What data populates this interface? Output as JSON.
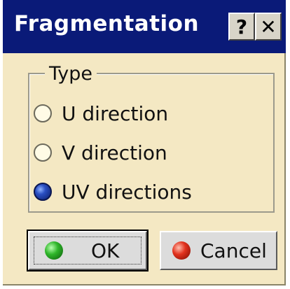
{
  "window": {
    "title": "Fragmentation",
    "help_label": "?",
    "close_label": "✕"
  },
  "type_group": {
    "legend": "Type",
    "options": [
      {
        "label": "U direction",
        "selected": false
      },
      {
        "label": "V direction",
        "selected": false
      },
      {
        "label": "UV directions",
        "selected": true
      }
    ]
  },
  "buttons": {
    "ok_label": "OK",
    "cancel_label": "Cancel"
  },
  "colors": {
    "titlebar": "#0a1a78",
    "dialog_bg": "#f4e8c3",
    "selected_radio": "#2a4fc2",
    "ok_icon": "#2fb62a",
    "cancel_icon": "#e2321e"
  }
}
